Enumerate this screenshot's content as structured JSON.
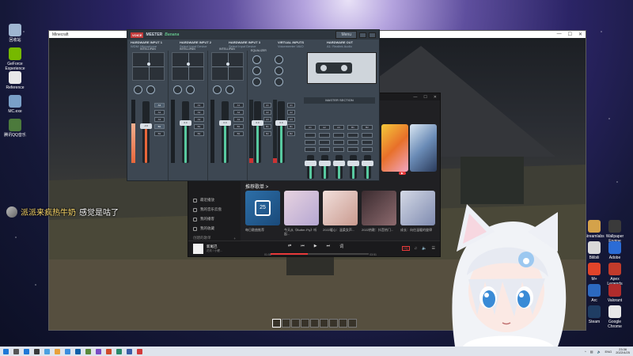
{
  "game": {
    "title": "Minecraft"
  },
  "desktop_icons_left": [
    {
      "label": "回收站",
      "color": "#9fb6d1"
    },
    {
      "label": "GeForce Experience",
      "color": "#76b900"
    },
    {
      "label": "Reference",
      "color": "#e8e8e8"
    },
    {
      "label": "MC.exe",
      "color": "#7aa0c8"
    },
    {
      "label": "腾讯QQ音乐",
      "color": "#4c7a3c"
    }
  ],
  "desktop_icons_right": [
    {
      "label": "Streamlabs",
      "color": "#d4a24a"
    },
    {
      "label": "Wallpaper Engine",
      "color": "#3a3a3a"
    },
    {
      "label": "Bilibili",
      "color": "#d9d9d9"
    },
    {
      "label": "Adobe",
      "color": "#2b6cd6"
    },
    {
      "label": "M+",
      "color": "#e0442a"
    },
    {
      "label": "Apex Legends",
      "color": "#c23b2b"
    },
    {
      "label": "Arc",
      "color": "#2c69c0"
    },
    {
      "label": "Valorant",
      "color": "#b02c2c"
    },
    {
      "label": "Steam",
      "color": "#1f3d63"
    },
    {
      "label": "Google Chrome",
      "color": "#e8e8e8"
    }
  ],
  "voicemeeter": {
    "logo_badge": "VOICE",
    "logo_text": "MEETER",
    "edition": "Banana",
    "menu_label": "Menu",
    "strips": [
      {
        "name": "HARDWARE INPUT 1",
        "device": "WDM: Microphone",
        "section": "INTELLIPAN",
        "fader_value": "-3.6",
        "fader_level": 0.55,
        "color": "#e8663a"
      },
      {
        "name": "HARDWARE INPUT 2",
        "device": "Select Input Device",
        "section": "INTELLIPAN",
        "fader_value": "0.0",
        "fader_level": 0.6,
        "color": "#58c9a0"
      },
      {
        "name": "HARDWARE INPUT 3",
        "device": "Select Input Device",
        "section": "INTELLIPAN",
        "fader_value": "0.0",
        "fader_level": 0.6,
        "color": "#58c9a0"
      }
    ],
    "virtual": {
      "title": "VIRTUAL INPUTS",
      "sub1": "Voicemeeter VAIO",
      "sub2": "Voicemeeter AUX",
      "section": "EQUALIZER"
    },
    "hw_out": {
      "title": "HARDWARE OUT",
      "device": "A1: Realtek Audio"
    },
    "bus_labels": [
      "A1",
      "A2",
      "A3",
      "B1",
      "B2"
    ],
    "master_title": "MASTER SECTION",
    "master_buses": [
      "A1",
      "A2",
      "A3",
      "B1",
      "B2"
    ]
  },
  "music": {
    "nav": [
      "精选",
      "播客",
      "排行"
    ],
    "sidebar": [
      {
        "label": "最近播放"
      },
      {
        "label": "我的音乐云盘"
      },
      {
        "label": "我的播客"
      },
      {
        "label": "我的收藏"
      },
      {
        "label": "创建的歌单"
      },
      {
        "label": "我喜欢的音乐"
      }
    ],
    "section_title": "推荐歌单 >",
    "tiles": [
      {
        "caption": "每日歌曲推荐",
        "colors": [
          "#2d6fa8",
          "#1a4a7a"
        ],
        "day": "25"
      },
      {
        "caption": "今天从《Butter-Fly》听起...",
        "colors": [
          "#e7d3e0",
          "#b6a7d2"
        ]
      },
      {
        "caption": "2022暖心：温柔女声...",
        "colors": [
          "#f1dfdb",
          "#c99a8f"
        ]
      },
      {
        "caption": "2022热歌：抖音热门...",
        "colors": [
          "#3a2b2f",
          "#8d6a6e"
        ]
      },
      {
        "caption": "成长：向往温暖的旋律",
        "colors": [
          "#d4d9e6",
          "#7f8bb0"
        ]
      }
    ],
    "player": {
      "song": "新尾巴",
      "artist": "花玖 / 小鲤...",
      "time_current": "01:08",
      "time_total": "03:51",
      "quality": "HQ"
    }
  },
  "chat": {
    "user": "派派来疯热牛奶",
    "message": "感觉是咕了"
  },
  "taskbar": {
    "apps": [
      "#1e78d6",
      "#3a3a3a",
      "#4aa0e0",
      "#e8a03a",
      "#3a8dde",
      "#0f5fa8",
      "#5a8a3a",
      "#7a4cc4",
      "#d04a2a",
      "#2a8a6a",
      "#3a5ea8",
      "#d23a3a"
    ],
    "lang": "ENG",
    "time": "23:36",
    "date": "2022/4/25"
  }
}
